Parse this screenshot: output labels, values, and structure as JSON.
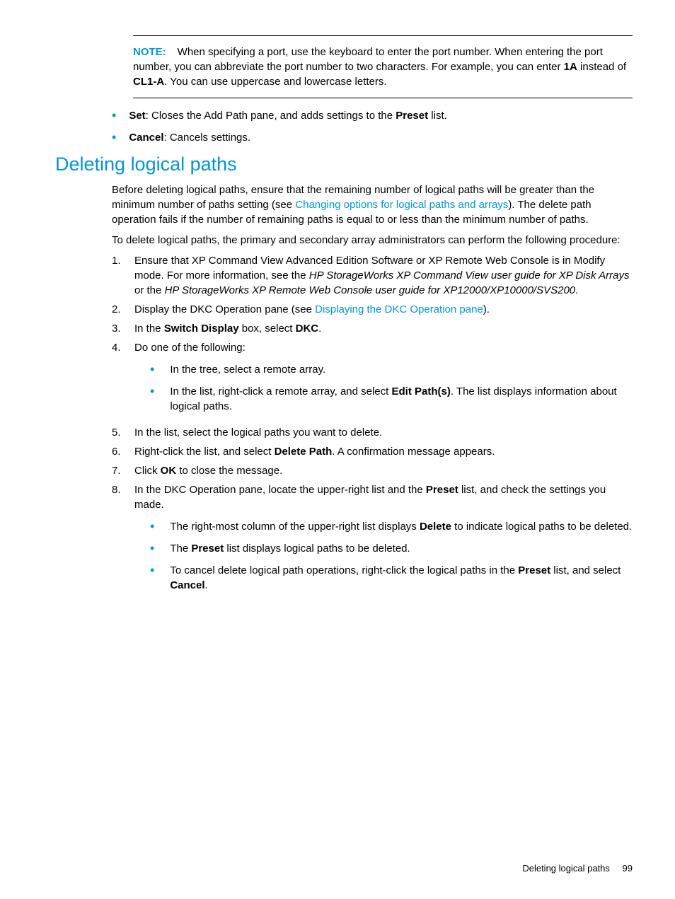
{
  "note": {
    "label": "NOTE:",
    "text_before": "When specifying a port, use the keyboard to enter the port number. When entering the port number, you can abbreviate the port number to two characters. For example, you can enter ",
    "bold1": "1A",
    "mid": " instead of ",
    "bold2": "CL1-A",
    "after": ". You can use uppercase and lowercase letters."
  },
  "top_bullets": [
    {
      "bold": "Set",
      "rest": ": Closes the Add Path pane, and adds settings to the ",
      "bold2": "Preset",
      "tail": " list."
    },
    {
      "bold": "Cancel",
      "rest": ": Cancels settings."
    }
  ],
  "heading": "Deleting logical paths",
  "para1": {
    "before": "Before deleting logical paths, ensure that the remaining number of logical paths will be greater than the minimum number of paths setting (see ",
    "link": "Changing options for logical paths and arrays",
    "after": "). The delete path operation fails if the number of remaining paths is equal to or less than the minimum number of paths."
  },
  "para2": "To delete logical paths, the primary and secondary array administrators can perform the following procedure:",
  "steps": {
    "s1": {
      "num": "1.",
      "text": "Ensure that XP Command View Advanced Edition Software or XP Remote Web Console is in Modify mode. For more information, see the ",
      "it1": "HP StorageWorks XP Command View user guide for XP Disk Arrays",
      "mid": " or the ",
      "it2": "HP StorageWorks XP Remote Web Console user guide for XP12000/XP10000/SVS200",
      "tail": "."
    },
    "s2": {
      "num": "2.",
      "before": "Display the DKC Operation pane (see ",
      "link": "Displaying the DKC Operation pane",
      "after": ")."
    },
    "s3": {
      "num": "3.",
      "t1": "In the ",
      "b1": "Switch Display",
      "t2": " box, select ",
      "b2": "DKC",
      "t3": "."
    },
    "s4": {
      "num": "4.",
      "text": "Do one of the following:",
      "sub": [
        {
          "text": "In the tree, select a remote array."
        },
        {
          "before": "In the list, right-click a remote array, and select ",
          "bold": "Edit Path(s)",
          "after": ". The list displays information about logical paths."
        }
      ]
    },
    "s5": {
      "num": "5.",
      "text": "In the list, select the logical paths you want to delete."
    },
    "s6": {
      "num": "6.",
      "t1": "Right-click the list, and select ",
      "b1": "Delete Path",
      "t2": ". A confirmation message appears."
    },
    "s7": {
      "num": "7.",
      "t1": "Click ",
      "b1": "OK",
      "t2": " to close the message."
    },
    "s8": {
      "num": "8.",
      "t1": "In the DKC Operation pane, locate the upper-right list and the ",
      "b1": "Preset",
      "t2": " list, and check the settings you made.",
      "sub": [
        {
          "before": "The right-most column of the upper-right list displays ",
          "bold": "Delete",
          "after": " to indicate logical paths to be deleted."
        },
        {
          "before": "The ",
          "bold": "Preset",
          "after": " list displays logical paths to be deleted."
        },
        {
          "before": "To cancel delete logical path operations, right-click the logical paths in the ",
          "bold": "Preset",
          "mid": " list, and select ",
          "bold2": "Cancel",
          "after": "."
        }
      ]
    }
  },
  "footer": {
    "title": "Deleting logical paths",
    "page": "99"
  }
}
